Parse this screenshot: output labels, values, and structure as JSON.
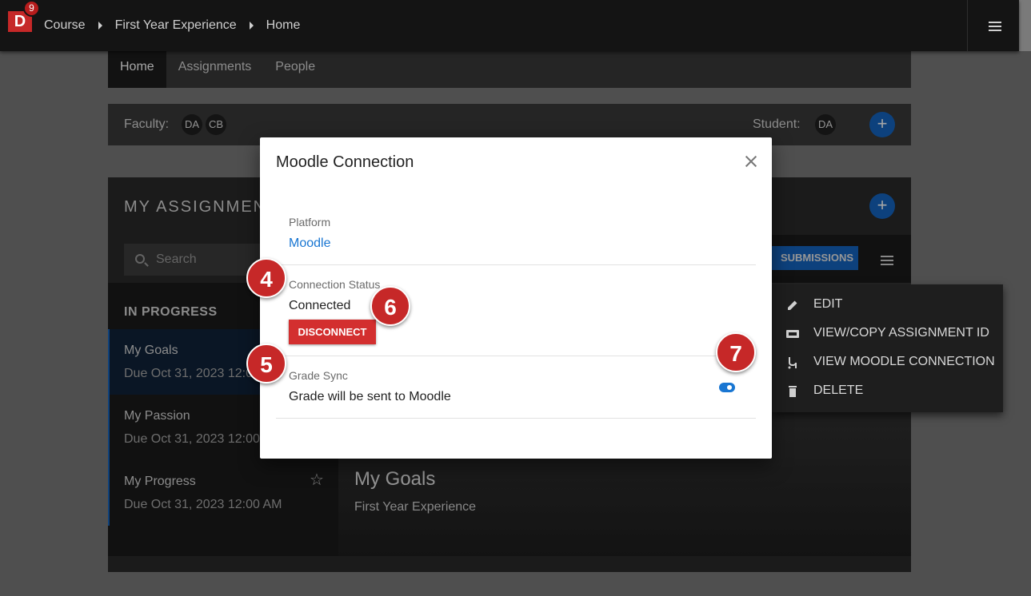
{
  "topbar": {
    "logo_letter": "D",
    "notification_count": "9",
    "breadcrumbs": [
      "Course",
      "First Year Experience",
      "Home"
    ]
  },
  "tabs": [
    "Home",
    "Assignments",
    "People"
  ],
  "people": {
    "faculty_label": "Faculty:",
    "faculty": [
      "DA",
      "CB"
    ],
    "student_label": "Student:",
    "students": [
      "DA"
    ],
    "add_label": "+"
  },
  "assignments": {
    "title": "MY ASSIGNMEN",
    "add_label": "+",
    "search_placeholder": "Search",
    "section": "IN PROGRESS",
    "items": [
      {
        "title": "My Goals",
        "due": "Due Oct 31, 2023 12:0"
      },
      {
        "title": "My Passion",
        "due": "Due Oct 31, 2023 12:00"
      },
      {
        "title": "My Progress",
        "due": "Due Oct 31, 2023 12:00 AM"
      }
    ],
    "star": "☆",
    "submissions_label": "SUBMISSIONS",
    "hero_title": "My Goals",
    "hero_subtitle": "First Year Experience"
  },
  "menu": {
    "items": [
      {
        "label": "EDIT",
        "icon": "pencil-icon"
      },
      {
        "label": "VIEW/COPY ASSIGNMENT ID",
        "icon": "id-icon"
      },
      {
        "label": "VIEW MOODLE CONNECTION",
        "icon": "connection-icon"
      },
      {
        "label": "DELETE",
        "icon": "trash-icon"
      }
    ]
  },
  "modal": {
    "title": "Moodle Connection",
    "platform_label": "Platform",
    "platform_value": "Moodle",
    "status_label": "Connection Status",
    "status_value": "Connected",
    "disconnect_label": "DISCONNECT",
    "sync_label": "Grade Sync",
    "sync_value": "Grade will be sent to Moodle",
    "sync_enabled": true
  },
  "callouts": [
    "4",
    "5",
    "6",
    "7"
  ],
  "colors": {
    "accent": "#1976d2",
    "danger": "#d32f2f",
    "callout": "#c62828"
  }
}
